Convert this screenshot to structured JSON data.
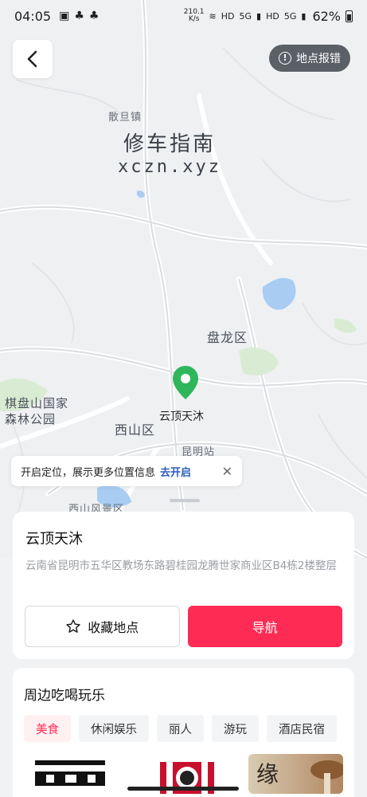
{
  "status_bar": {
    "time": "04:05",
    "net_speed_value": "210.1",
    "net_speed_unit": "K/s",
    "hd1": "HD",
    "hd2": "HD",
    "sig1": "5G",
    "sig2": "5G",
    "battery": "62%"
  },
  "header": {
    "report_label": "地点报错",
    "report_icon_text": "!"
  },
  "map": {
    "labels": {
      "sandan": "散旦镇",
      "panlong": "盘龙区",
      "xishan": "西山区",
      "qipan_1": "棋盘山国家",
      "qipan_2": "森林公园",
      "kunming_station": "昆明站",
      "xishan_scenic": "西山风景区"
    },
    "watermark_cn": "修车指南",
    "watermark_en": "xczn.xyz",
    "pin_label": "云顶天沐"
  },
  "location_tip": {
    "text": "开启定位，展示更多位置信息",
    "action": "去开启",
    "close": "✕"
  },
  "place": {
    "name": "云顶天沐",
    "address": "云南省昆明市五华区教场东路碧桂园龙腾世家商业区B4栋2楼整层",
    "favorite_label": "收藏地点",
    "navigate_label": "导航"
  },
  "nearby": {
    "title": "周边吃喝玩乐",
    "categories": [
      "美食",
      "休闲娱乐",
      "丽人",
      "游玩",
      "酒店民宿"
    ],
    "thumb_texts": [
      "",
      "",
      "缘"
    ]
  },
  "colors": {
    "accent": "#fe2c55",
    "pin": "#2fb65b",
    "link": "#2b5dbd"
  }
}
